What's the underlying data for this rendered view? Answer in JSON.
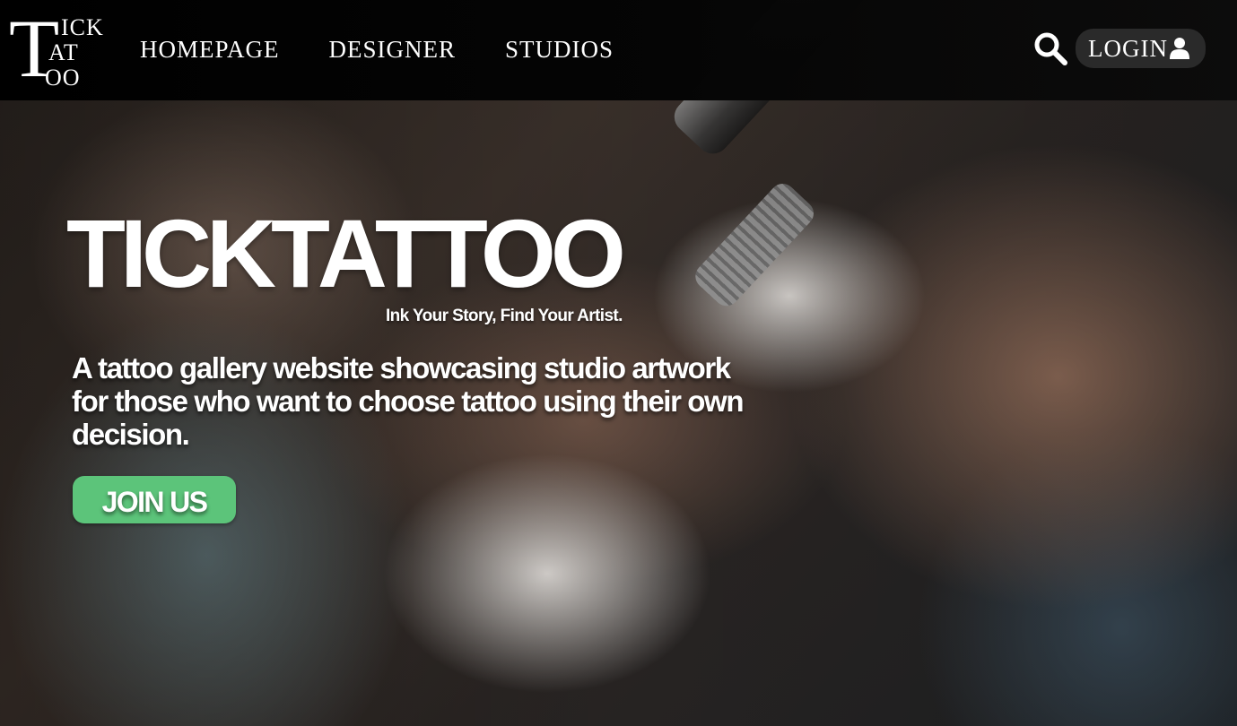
{
  "logo": {
    "big_letter": "T",
    "line1": "ICK",
    "line2": "AT",
    "line3": "OO"
  },
  "nav": {
    "items": [
      {
        "label": "HOMEPAGE"
      },
      {
        "label": "DESIGNER"
      },
      {
        "label": "STUDIOS"
      }
    ]
  },
  "header": {
    "search_icon": "search-icon",
    "login_label": "LOGIN",
    "user_icon": "user-icon"
  },
  "hero": {
    "title": "TICKTATTOO",
    "tagline": "Ink Your Story, Find Your Artist.",
    "description": "A tattoo gallery website showcasing studio artwork for those who want to choose tattoo using their own decision.",
    "cta_label": "JOIN US"
  },
  "colors": {
    "accent": "#5cc47a",
    "topbar": "#000000",
    "login_bg": "#2a2a2a",
    "text": "#ffffff"
  }
}
